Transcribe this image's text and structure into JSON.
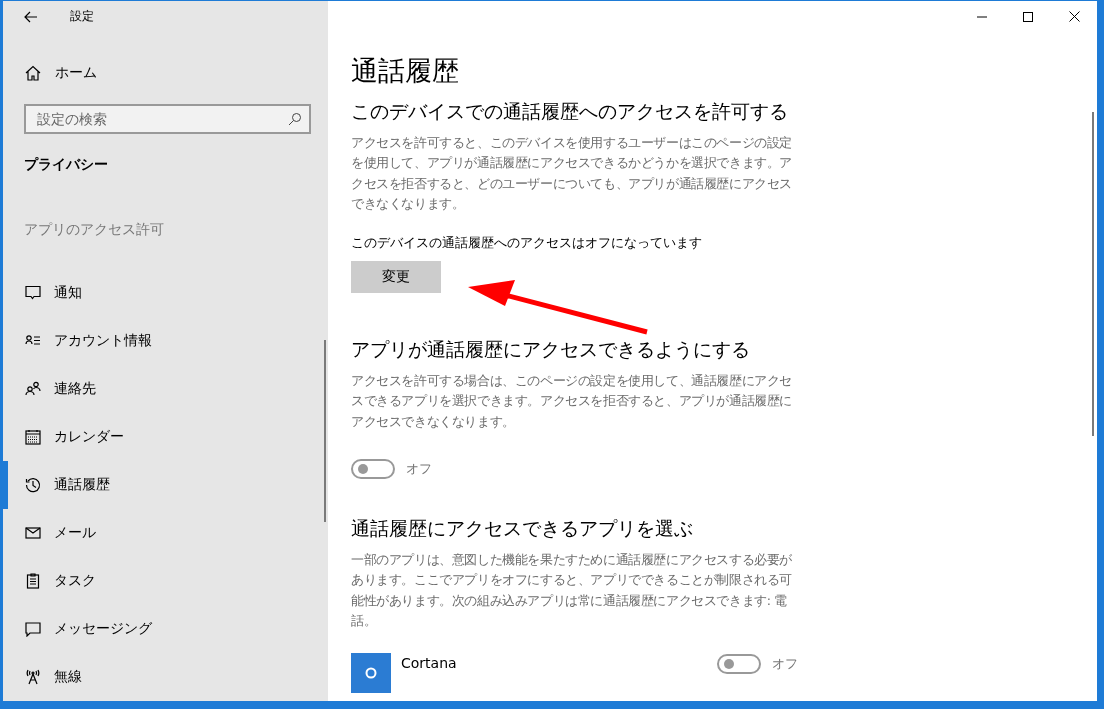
{
  "window": {
    "title": "設定"
  },
  "sidebar": {
    "home": "ホーム",
    "search": {
      "placeholder": "設定の検索"
    },
    "category": "プライバシー",
    "section": "アプリのアクセス許可",
    "items": [
      {
        "label": "通知",
        "kind": "notification",
        "selected": false
      },
      {
        "label": "アカウント情報",
        "kind": "account",
        "selected": false
      },
      {
        "label": "連絡先",
        "kind": "contacts",
        "selected": false
      },
      {
        "label": "カレンダー",
        "kind": "calendar",
        "selected": false
      },
      {
        "label": "通話履歴",
        "kind": "history",
        "selected": true
      },
      {
        "label": "メール",
        "kind": "mail",
        "selected": false
      },
      {
        "label": "タスク",
        "kind": "tasks",
        "selected": false
      },
      {
        "label": "メッセージング",
        "kind": "messaging",
        "selected": false
      },
      {
        "label": "無線",
        "kind": "radio",
        "selected": false
      }
    ]
  },
  "page": {
    "title": "通話履歴",
    "device_section": {
      "heading": "このデバイスでの通話履歴へのアクセスを許可する",
      "description": "アクセスを許可すると、このデバイスを使用するユーザーはこのページの設定を使用して、アプリが通話履歴にアクセスできるかどうかを選択できます。アクセスを拒否すると、どのユーザーについても、アプリが通話履歴にアクセスできなくなります。",
      "status": "このデバイスの通話履歴へのアクセスはオフになっています",
      "button": "変更"
    },
    "apps_section": {
      "heading": "アプリが通話履歴にアクセスできるようにする",
      "description": "アクセスを許可する場合は、このページの設定を使用して、通話履歴にアクセスできるアプリを選択できます。アクセスを拒否すると、アプリが通話履歴にアクセスできなくなります。",
      "toggle": {
        "on": false,
        "label": "オフ"
      }
    },
    "choose_section": {
      "heading": "通話履歴にアクセスできるアプリを選ぶ",
      "description": "一部のアプリは、意図した機能を果たすために通話履歴にアクセスする必要があります。ここでアプリをオフにすると、アプリでできることが制限される可能性があります。次の組み込みアプリは常に通話履歴にアクセスできます: 電話。",
      "apps": [
        {
          "name": "Cortana",
          "toggle": {
            "on": false,
            "label": "オフ"
          }
        }
      ]
    }
  }
}
